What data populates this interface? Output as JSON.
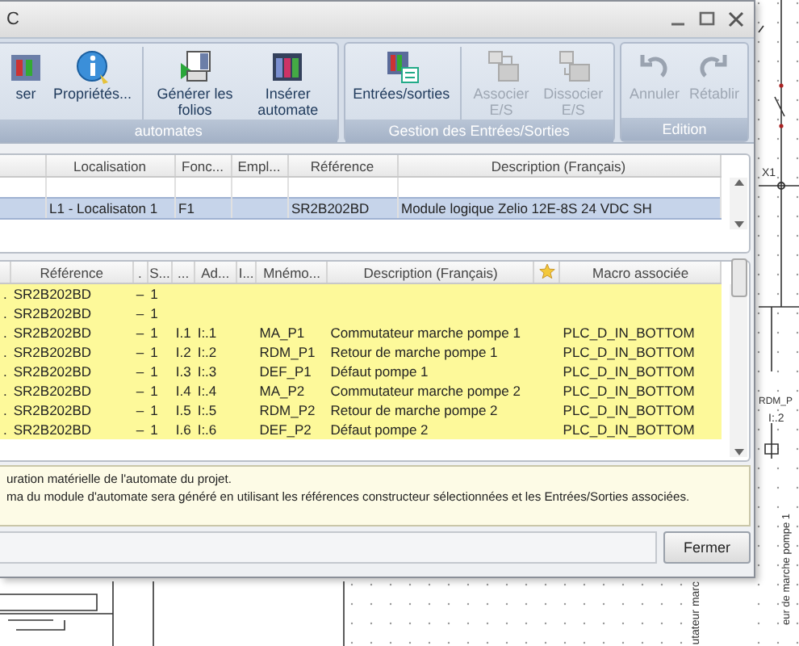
{
  "window": {
    "title": "C"
  },
  "ribbon": {
    "groups": [
      {
        "label": "automates",
        "buttons": [
          {
            "label": "ser",
            "disabled": false,
            "separator_before": false
          },
          {
            "label": "Propriétés...",
            "disabled": false,
            "separator_before": false
          },
          {
            "label": "Générer les folios",
            "disabled": false,
            "separator_before": true
          },
          {
            "label": "Insérer automate",
            "disabled": false,
            "separator_before": false
          }
        ]
      },
      {
        "label": "Gestion des Entrées/Sorties",
        "buttons": [
          {
            "label": "Entrées/sorties",
            "disabled": false,
            "separator_before": false
          },
          {
            "label": "Associer E/S",
            "disabled": true,
            "separator_before": true
          },
          {
            "label": "Dissocier E/S",
            "disabled": true,
            "separator_before": false
          }
        ]
      },
      {
        "label": "Edition",
        "buttons": [
          {
            "label": "Annuler",
            "disabled": true,
            "separator_before": false
          },
          {
            "label": "Rétablir",
            "disabled": true,
            "separator_before": false
          }
        ]
      }
    ]
  },
  "plc_table": {
    "columns": [
      {},
      {
        "label": "Localisation"
      },
      {
        "label": "Fonc..."
      },
      {
        "label": "Empl..."
      },
      {
        "label": "Référence"
      },
      {
        "label": "Description (Français)"
      }
    ],
    "rows": [
      {
        "selected": true,
        "cells": [
          "",
          "L1 - Localisaton 1",
          "F1",
          "",
          "SR2B202BD",
          "Module logique Zelio 12E-8S 24 VDC SH"
        ]
      }
    ]
  },
  "io_table": {
    "columns": [
      {},
      {
        "label": "Référence"
      },
      {
        "label": "."
      },
      {
        "label": "S..."
      },
      {
        "label": "..."
      },
      {
        "label": "Ad..."
      },
      {
        "label": "I..."
      },
      {
        "label": "Mnémo..."
      },
      {
        "label": "Description (Français)"
      },
      {
        "kind": "star"
      },
      {
        "label": "Macro associée"
      }
    ],
    "rows": [
      {
        "cells": [
          ".",
          "SR2B202BD",
          "–",
          "1",
          "",
          "",
          "",
          "",
          "",
          "",
          ""
        ]
      },
      {
        "cells": [
          ".",
          "SR2B202BD",
          "–",
          "1",
          "",
          "",
          "",
          "",
          "",
          "",
          ""
        ]
      },
      {
        "cells": [
          ".",
          "SR2B202BD",
          "–",
          "1",
          "I.1",
          "I:.1",
          "",
          "MA_P1",
          "Commutateur marche pompe 1",
          "",
          "PLC_D_IN_BOTTOM"
        ]
      },
      {
        "cells": [
          ".",
          "SR2B202BD",
          "–",
          "1",
          "I.2",
          "I:.2",
          "",
          "RDM_P1",
          "Retour de marche pompe 1",
          "",
          "PLC_D_IN_BOTTOM"
        ]
      },
      {
        "cells": [
          ".",
          "SR2B202BD",
          "–",
          "1",
          "I.3",
          "I:.3",
          "",
          "DEF_P1",
          "Défaut pompe 1",
          "",
          "PLC_D_IN_BOTTOM"
        ]
      },
      {
        "cells": [
          ".",
          "SR2B202BD",
          "–",
          "1",
          "I.4",
          "I:.4",
          "",
          "MA_P2",
          "Commutateur marche pompe 2",
          "",
          "PLC_D_IN_BOTTOM"
        ]
      },
      {
        "cells": [
          ".",
          "SR2B202BD",
          "–",
          "1",
          "I.5",
          "I:.5",
          "",
          "RDM_P2",
          "Retour de marche pompe 2",
          "",
          "PLC_D_IN_BOTTOM"
        ]
      },
      {
        "cells": [
          ".",
          "SR2B202BD",
          "–",
          "1",
          "I.6",
          "I:.6",
          "",
          "DEF_P2",
          "Défaut pompe 2",
          "",
          "PLC_D_IN_BOTTOM"
        ]
      }
    ]
  },
  "info": {
    "lines": [
      "uration matérielle de l'automate du projet.",
      "ma du module d'automate sera généré en utilisant les références constructeur sélectionnées et les Entrées/Sorties associées."
    ]
  },
  "footer": {
    "button": "Fermer"
  },
  "schematic": {
    "labels": [
      {
        "text": "X1",
        "kind": "flat"
      },
      {
        "text": "RDM_P",
        "kind": "flat"
      },
      {
        "text": "I:.2",
        "kind": "flat"
      },
      {
        "text": "utateur marc",
        "kind": "vertical"
      },
      {
        "text": "eur de marche pompe 1",
        "kind": "vertical"
      }
    ]
  }
}
